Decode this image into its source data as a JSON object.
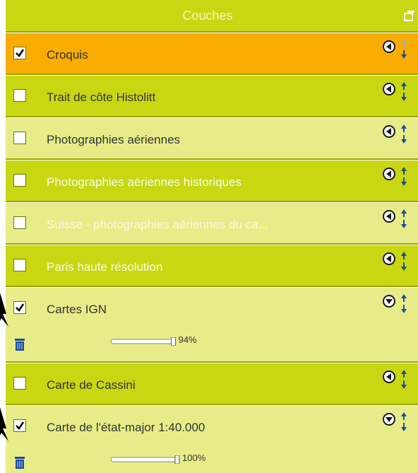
{
  "panel": {
    "title": "Couches"
  },
  "layers": [
    {
      "label": "Croquis",
      "checked": true,
      "dimmed": false,
      "bg": "orange",
      "expanded": false
    },
    {
      "label": "Trait de côte Histolitt",
      "checked": false,
      "dimmed": false,
      "bg": "dark",
      "expanded": false
    },
    {
      "label": "Photographies aériennes",
      "checked": false,
      "dimmed": false,
      "bg": "light",
      "expanded": false
    },
    {
      "label": "Photographies aériennes historiques",
      "checked": false,
      "dimmed": true,
      "bg": "dark",
      "expanded": false
    },
    {
      "label": "Suisse - photographies aériennes du ca...",
      "checked": false,
      "dimmed": true,
      "bg": "light",
      "expanded": false
    },
    {
      "label": "Paris haute résolution",
      "checked": false,
      "dimmed": true,
      "bg": "dark",
      "expanded": false
    },
    {
      "label": "Cartes IGN",
      "checked": true,
      "dimmed": false,
      "bg": "light",
      "expanded": true,
      "opacity_label": "94%",
      "opacity": 0.94
    },
    {
      "label": "Carte de Cassini",
      "checked": false,
      "dimmed": false,
      "bg": "dark",
      "expanded": false
    },
    {
      "label": "Carte de l'état-major 1:40.000",
      "checked": true,
      "dimmed": false,
      "bg": "light",
      "expanded": true,
      "opacity_label": "100%",
      "opacity": 1.0
    }
  ],
  "colors": {
    "header": "#c8d712",
    "orange": "#f8ad00",
    "dark": "#c8d712",
    "light": "#e8ec88",
    "icon": "#1f4b9a"
  },
  "icons": {
    "collapsed": "circle-arrow-left-icon",
    "expanded": "circle-arrow-down-icon",
    "reorder": "up-down-arrows-icon",
    "delete": "trash-icon",
    "undock": "undock-window-icon"
  }
}
